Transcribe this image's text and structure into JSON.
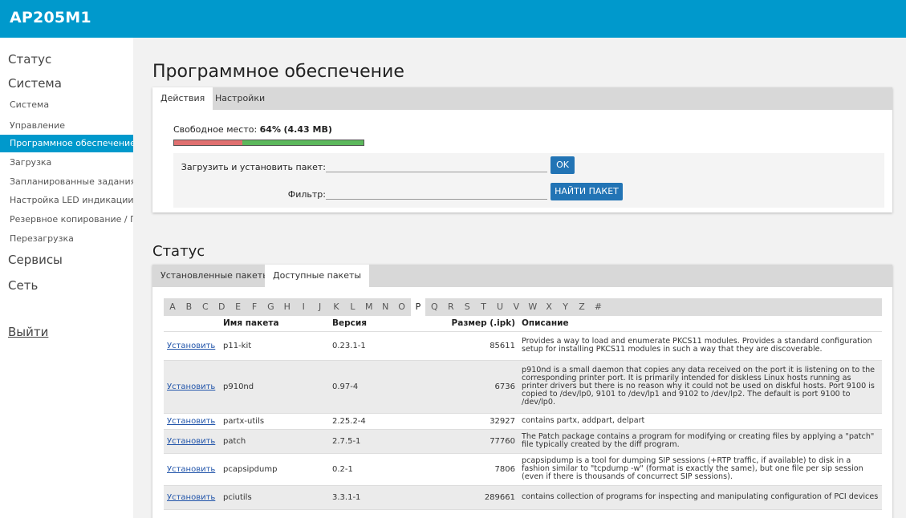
{
  "app": {
    "title": "AP205M1"
  },
  "sidebar": {
    "status": "Статус",
    "system": "Система",
    "subitems": [
      "Система",
      "Управление",
      "Программное обеспечение",
      "Загрузка",
      "Запланированные задания",
      "Настройка LED индикации",
      "Резервное копирование / Г",
      "Перезагрузка"
    ],
    "services": "Сервисы",
    "network": "Сеть",
    "logout": "Выйти"
  },
  "page": {
    "title": "Программное обеспечение"
  },
  "actions_panel": {
    "tabs": [
      "Действия",
      "Настройки"
    ],
    "free_space": {
      "label": "Свободное место:",
      "percent": "64%",
      "size": "(4.43 MB)",
      "used_fraction": 0.36
    },
    "upload_label": "Загрузить и установить пакет:",
    "upload_value": "",
    "ok_button": "OK",
    "filter_label": "Фильтр:",
    "filter_value": "",
    "find_button": "НАЙТИ ПАКЕТ"
  },
  "status_section": {
    "title": "Статус",
    "tabs": [
      "Установленные пакеты",
      "Доступные пакеты"
    ],
    "letters": [
      "A",
      "B",
      "C",
      "D",
      "E",
      "F",
      "G",
      "H",
      "I",
      "J",
      "K",
      "L",
      "M",
      "N",
      "O",
      "P",
      "Q",
      "R",
      "S",
      "T",
      "U",
      "V",
      "W",
      "X",
      "Y",
      "Z",
      "#"
    ],
    "active_letter": "P",
    "columns": [
      "",
      "Имя пакета",
      "Версия",
      "Размер (.ipk)",
      "Описание"
    ],
    "rows": [
      {
        "action": "Установить",
        "name": "p11-kit",
        "version": "0.23.1-1",
        "size": "85611",
        "desc": "Provides a way to load and enumerate PKCS11 modules. Provides a standard configuration setup for installing PKCS11 modules in such a way that they are discoverable."
      },
      {
        "action": "Установить",
        "name": "p910nd",
        "version": "0.97-4",
        "size": "6736",
        "desc": "p910nd is a small daemon that copies any data received on the port it is listening on to the corresponding printer port. It is primarily intended for diskless Linux hosts running as printer drivers but there is no reason why it could not be used on diskful hosts. Port 9100 is copied to /dev/lp0, 9101 to /dev/lp1 and 9102 to /dev/lp2. The default is port 9100 to /dev/lp0."
      },
      {
        "action": "Установить",
        "name": "partx-utils",
        "version": "2.25.2-4",
        "size": "32927",
        "desc": "contains partx, addpart, delpart"
      },
      {
        "action": "Установить",
        "name": "patch",
        "version": "2.7.5-1",
        "size": "77760",
        "desc": "The Patch package contains a program for modifying or creating files by applying a \"patch\" file typically created by the diff program."
      },
      {
        "action": "Установить",
        "name": "pcapsipdump",
        "version": "0.2-1",
        "size": "7806",
        "desc": "pcapsipdump is a tool for dumping SIP sessions (+RTP traffic, if available) to disk in a fashion similar to \"tcpdump -w\" (format is exactly the same), but one file per sip session (even if there is thousands of concurrect SIP sessions)."
      },
      {
        "action": "Установить",
        "name": "pciutils",
        "version": "3.3.1-1",
        "size": "289661",
        "desc": "contains collection of programs for inspecting and manipulating configuration of PCI devices"
      }
    ]
  }
}
